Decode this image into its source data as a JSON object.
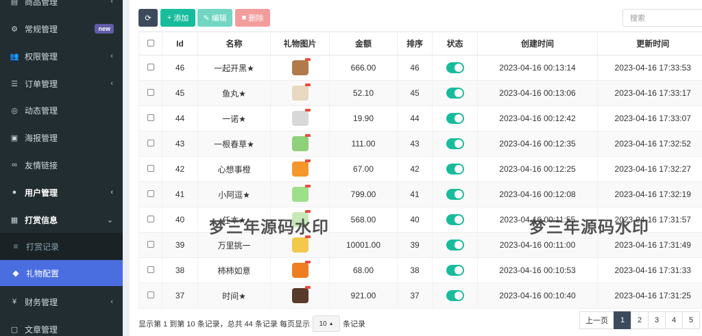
{
  "sidebar": {
    "items": [
      {
        "label": "商品管理",
        "icon": "package-icon"
      },
      {
        "label": "常规管理",
        "icon": "cogs-icon",
        "badge": "new"
      },
      {
        "label": "权限管理",
        "icon": "users-icon"
      },
      {
        "label": "订单管理",
        "icon": "list-icon"
      },
      {
        "label": "动态管理",
        "icon": "eye-icon"
      },
      {
        "label": "海报管理",
        "icon": "image-icon"
      },
      {
        "label": "友情链接",
        "icon": "link-icon"
      },
      {
        "label": "用户管理",
        "icon": "user-circle-icon"
      },
      {
        "label": "打赏信息",
        "icon": "gift-icon"
      },
      {
        "label": "打赏记录",
        "icon": "bars-icon"
      },
      {
        "label": "礼物配置",
        "icon": "cube-icon"
      },
      {
        "label": "财务管理",
        "icon": "yen-icon"
      },
      {
        "label": "文章管理",
        "icon": "file-icon"
      }
    ]
  },
  "toolbar": {
    "add_label": "添加",
    "edit_label": "编辑",
    "delete_label": "删除",
    "search_placeholder": "搜索"
  },
  "table": {
    "headers": [
      "Id",
      "名称",
      "礼物图片",
      "金额",
      "排序",
      "状态",
      "创建时间",
      "更新时间"
    ],
    "rows": [
      {
        "id": "46",
        "name": "一起开黑★",
        "amount": "666.00",
        "sort": "46",
        "created": "2023-04-16 00:13:14",
        "updated": "2023-04-16 17:33:53",
        "img_color": "#b07a4a"
      },
      {
        "id": "45",
        "name": "鱼丸★",
        "amount": "52.10",
        "sort": "45",
        "created": "2023-04-16 00:13:06",
        "updated": "2023-04-16 17:33:17",
        "img_color": "#e8d9c0"
      },
      {
        "id": "44",
        "name": "一诺★",
        "amount": "19.90",
        "sort": "44",
        "created": "2023-04-16 00:12:42",
        "updated": "2023-04-16 17:33:07",
        "img_color": "#d8d8d8"
      },
      {
        "id": "43",
        "name": "一根春草★",
        "amount": "111.00",
        "sort": "43",
        "created": "2023-04-16 00:12:35",
        "updated": "2023-04-16 17:32:52",
        "img_color": "#8fd17a"
      },
      {
        "id": "42",
        "name": "心想事橙",
        "amount": "67.00",
        "sort": "42",
        "created": "2023-04-16 00:12:25",
        "updated": "2023-04-16 17:32:27",
        "img_color": "#f5962a"
      },
      {
        "id": "41",
        "name": "小阿逗★",
        "amount": "799.00",
        "sort": "41",
        "created": "2023-04-16 00:12:08",
        "updated": "2023-04-16 17:32:19",
        "img_color": "#9ee08a"
      },
      {
        "id": "40",
        "name": "任本★",
        "amount": "568.00",
        "sort": "40",
        "created": "2023-04-16 00:11:55",
        "updated": "2023-04-16 17:31:57",
        "img_color": "#c9e8b8"
      },
      {
        "id": "39",
        "name": "万里挑一",
        "amount": "10001.00",
        "sort": "39",
        "created": "2023-04-16 00:11:00",
        "updated": "2023-04-16 17:31:49",
        "img_color": "#f2c94c"
      },
      {
        "id": "38",
        "name": "柿柿如意",
        "amount": "68.00",
        "sort": "38",
        "created": "2023-04-16 00:10:53",
        "updated": "2023-04-16 17:31:33",
        "img_color": "#ef7d22"
      },
      {
        "id": "37",
        "name": "时间★",
        "amount": "921.00",
        "sort": "37",
        "created": "2023-04-16 00:10:40",
        "updated": "2023-04-16 17:31:25",
        "img_color": "#5a3a2a"
      }
    ]
  },
  "watermark": {
    "text": "梦三年源码水印"
  },
  "footer": {
    "summary": "显示第 1 到第 10 条记录，总共 44 条记录 每页显示",
    "page_size": "10",
    "suffix": "条记录"
  },
  "pagination": {
    "prev": "上一页",
    "pages": [
      "1",
      "2",
      "3",
      "4",
      "5"
    ]
  },
  "colors": {
    "accent": "#18bc9c",
    "sidebar_bg": "#222d32",
    "active": "#4a6ee0"
  }
}
